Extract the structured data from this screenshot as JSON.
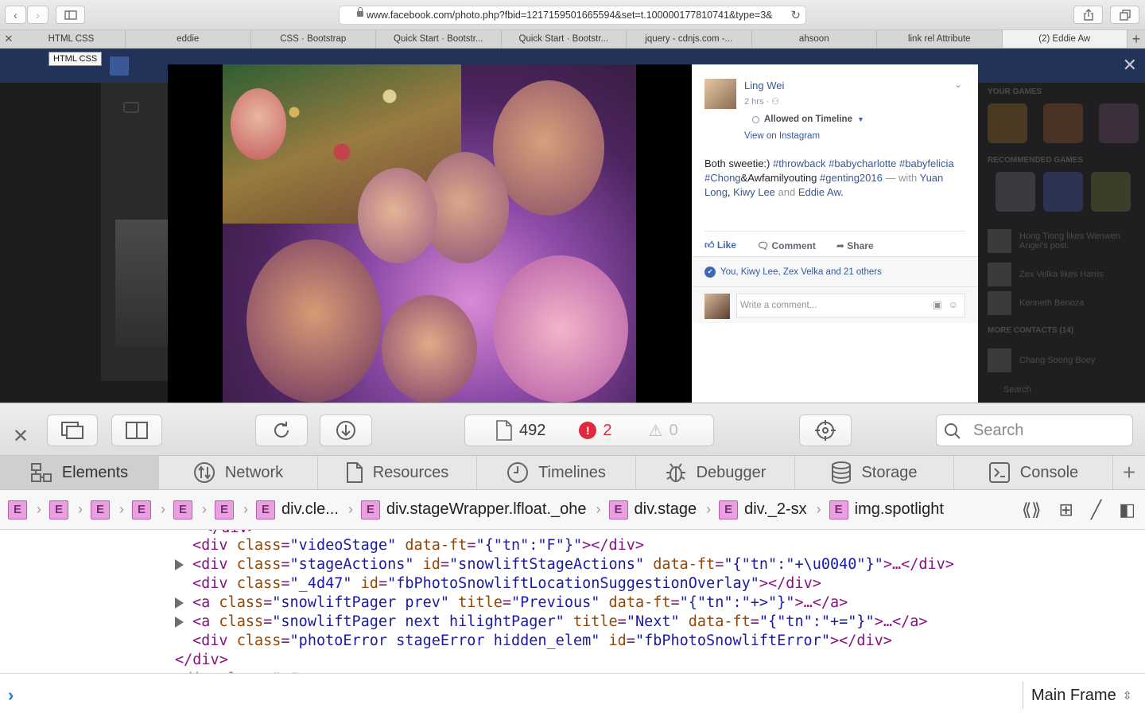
{
  "browser": {
    "url": "www.facebook.com/photo.php?fbid=1217159501665594&set=t.100000177810741&type=3&",
    "tabs": [
      "HTML CSS",
      "eddie",
      "CSS · Bootstrap",
      "Quick Start · Bootstr...",
      "Quick Start · Bootstr...",
      "jquery - cdnjs.com -...",
      "ahsoon",
      "link rel Attribute",
      "(2) Eddie Aw"
    ],
    "active_tab_index": 8,
    "tooltip": "HTML CSS"
  },
  "post": {
    "author": "Ling Wei",
    "time": "2 hrs",
    "audience_icon": "friends-icon",
    "timeline_status": "Allowed on Timeline",
    "view_on": "View on Instagram",
    "caption_text": "Both sweetie:)",
    "hashtags": [
      "#throwback",
      "#babycharlotte",
      "#babyfelicia",
      "#Chong"
    ],
    "caption_tail": "&Awfamilyouting",
    "hashtag_last": "#genting2016",
    "with_text": "— with",
    "tagged": [
      "Yuan Long",
      "Kiwy Lee"
    ],
    "and_text": "and",
    "tagged_last": "Eddie Aw",
    "period": ".",
    "actions": {
      "like": "Like",
      "comment": "Comment",
      "share": "Share"
    },
    "likes_summary": "You, Kiwy Lee, Zex Velka and 21 others",
    "comment_placeholder": "Write a comment..."
  },
  "sidebar": {
    "your_games": "YOUR GAMES",
    "recommended": "RECOMMENDED GAMES",
    "activity": [
      "Hong Tiong likes Wenwen Angel's post.",
      "Zex Velka likes Harris",
      "Kenneth Benoza"
    ],
    "more_contacts": "MORE CONTACTS (14)",
    "contact": "Chang Soong Boey",
    "search": "Search"
  },
  "inspector": {
    "resource_count": "492",
    "error_count": "2",
    "warning_count": "0",
    "search_placeholder": "Search",
    "tabs": [
      "Elements",
      "Network",
      "Resources",
      "Timelines",
      "Debugger",
      "Storage",
      "Console"
    ],
    "active_tab": "Elements",
    "breadcrumbs": [
      "",
      "",
      "",
      "",
      "",
      "",
      "div.cle...",
      "div.stageWrapper.lfloat._ohe",
      "div.stage",
      "div._2-sx",
      "img.spotlight"
    ],
    "dom_lines": [
      {
        "tag_open": "<div",
        "attrs": [
          [
            "class",
            "\"videoStage\""
          ],
          [
            "data-ft",
            "\"{\"tn\":\"F\"}\""
          ]
        ],
        "close": "></div>",
        "expandable": false
      },
      {
        "tag_open": "<div",
        "attrs": [
          [
            "class",
            "\"stageActions\""
          ],
          [
            "id",
            "\"snowliftStageActions\""
          ],
          [
            "data-ft",
            "\"{\"tn\":\"+\\u0040\"}\""
          ]
        ],
        "close": ">…</div>",
        "expandable": true
      },
      {
        "tag_open": "<div",
        "attrs": [
          [
            "class",
            "\"_4d47\""
          ],
          [
            "id",
            "\"fbPhotoSnowliftLocationSuggestionOverlay\""
          ]
        ],
        "close": "></div>",
        "expandable": false
      },
      {
        "tag_open": "<a",
        "attrs": [
          [
            "class",
            "\"snowliftPager prev\""
          ],
          [
            "title",
            "\"Previous\""
          ],
          [
            "data-ft",
            "\"{\"tn\":\"+>\"}\""
          ]
        ],
        "close": ">…</a>",
        "expandable": true
      },
      {
        "tag_open": "<a",
        "attrs": [
          [
            "class",
            "\"snowliftPager next hilightPager\""
          ],
          [
            "title",
            "\"Next\""
          ],
          [
            "data-ft",
            "\"{\"tn\":\"+=\"}\""
          ]
        ],
        "close": ">…</a>",
        "expandable": true
      },
      {
        "tag_open": "<div",
        "attrs": [
          [
            "class",
            "\"photoError stageError hidden_elem\""
          ],
          [
            "id",
            "\"fbPhotoSnowliftError\""
          ]
        ],
        "close": "></div>",
        "expandable": false
      }
    ],
    "dom_close": "</div>",
    "frame_selector": "Main Frame"
  }
}
